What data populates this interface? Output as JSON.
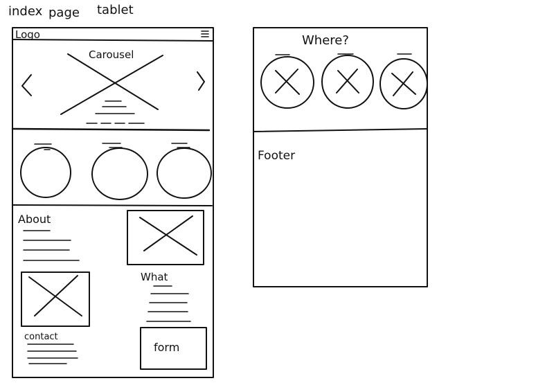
{
  "sketch": {
    "heading_index": "index",
    "heading_page": "page",
    "heading_tablet": "tablet"
  },
  "left_frame": {
    "logo": "Logo",
    "menu_icon": "hamburger-menu-icon",
    "carousel": "Carousel",
    "about": "About",
    "what": "What",
    "contact": "contact",
    "form": "form"
  },
  "right_frame": {
    "where": "Where?",
    "footer": "Footer"
  },
  "colors": {
    "ink": "#111111",
    "paper": "#ffffff"
  }
}
